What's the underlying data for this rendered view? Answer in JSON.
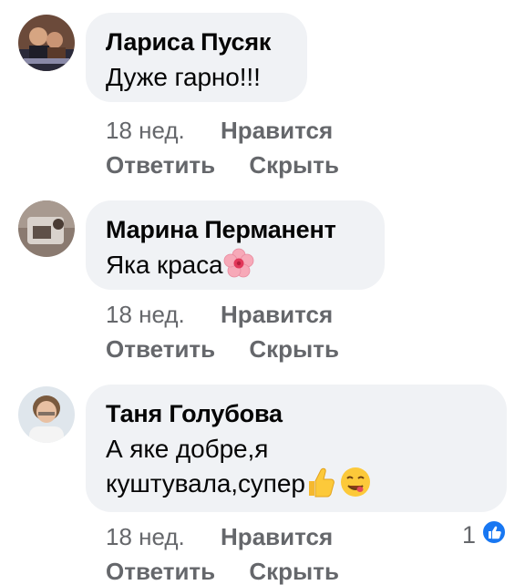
{
  "comments": [
    {
      "author": "Лариса Пусяк",
      "text": "Дуже гарно!!!",
      "time": "18 нед.",
      "like_label": "Нравится",
      "reply_label": "Ответить",
      "hide_label": "Скрыть"
    },
    {
      "author": "Марина Перманент",
      "text": "Яка краса",
      "emoji": "flower-emoji",
      "time": "18 нед.",
      "like_label": "Нравится",
      "reply_label": "Ответить",
      "hide_label": "Скрыть"
    },
    {
      "author": "Таня Голубова",
      "text_line1": "А яке добре,я",
      "text_line2": "куштувала,супер",
      "emojis": [
        "thumbs-up-emoji",
        "smirk-face-emoji"
      ],
      "time": "18 нед.",
      "like_label": "Нравится",
      "reply_label": "Ответить",
      "hide_label": "Скрыть",
      "reaction_count": "1",
      "reaction_icon": "like-reaction-icon"
    }
  ],
  "colors": {
    "bubble": "#f0f2f5",
    "meta": "#65676b",
    "like_blue": "#1877f2"
  }
}
